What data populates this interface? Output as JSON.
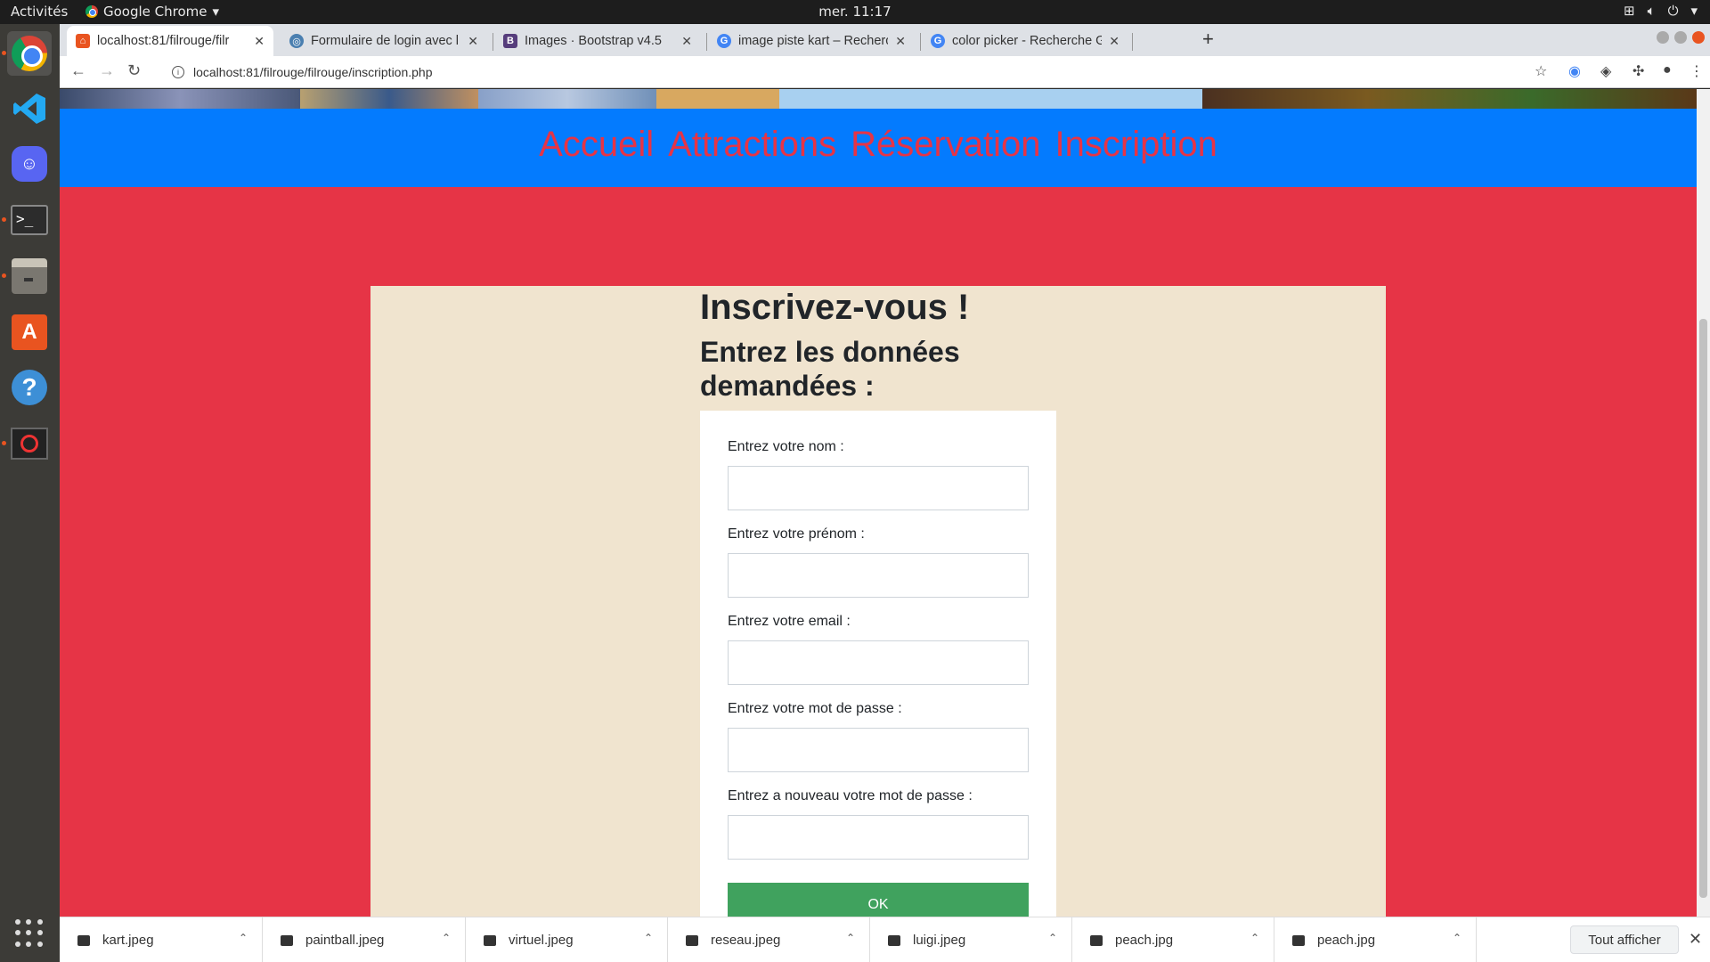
{
  "topbar": {
    "activities": "Activités",
    "app_name": "Google Chrome",
    "clock": "mer. 11:17"
  },
  "dock": {
    "apps": [
      "Google Chrome",
      "Visual Studio Code",
      "Discord",
      "Terminal",
      "Files",
      "Ubuntu Software",
      "Help",
      "Blocked app",
      "Show Applications"
    ]
  },
  "browser": {
    "tabs": [
      {
        "title": "localhost:81/filrouge/filr",
        "favicon": "site-icon",
        "color": "#e95420",
        "active": true
      },
      {
        "title": "Formulaire de login avec l",
        "favicon": "globe-icon",
        "color": "#4a7fb0",
        "active": false
      },
      {
        "title": "Images · Bootstrap v4.5",
        "favicon": "bootstrap-icon",
        "color": "#563d7c",
        "active": false
      },
      {
        "title": "image piste kart – Recherc",
        "favicon": "google-icon",
        "color": "#4285f4",
        "active": false
      },
      {
        "title": "color picker - Recherche G",
        "favicon": "google-icon",
        "color": "#4285f4",
        "active": false
      }
    ],
    "url": "localhost:81/filrouge/filrouge/inscription.php"
  },
  "page": {
    "nav": [
      "Accueil",
      "Attractions",
      "Réservation",
      "Inscription"
    ],
    "title": "Inscrivez-vous !",
    "subtitle": "Entrez les données demandées :",
    "form": {
      "fields": [
        {
          "label": "Entrez votre nom :",
          "value": "",
          "type": "text"
        },
        {
          "label": "Entrez votre prénom :",
          "value": "",
          "type": "text"
        },
        {
          "label": "Entrez votre email :",
          "value": "",
          "type": "email"
        },
        {
          "label": "Entrez votre mot de passe :",
          "value": "",
          "type": "password"
        },
        {
          "label": "Entrez a nouveau votre mot de passe :",
          "value": "",
          "type": "password"
        }
      ],
      "submit": "OK"
    },
    "colors": {
      "page_bg": "#e63446",
      "nav_bg": "#047bfe",
      "panel_bg": "#f0e4cf",
      "button": "#40a25e"
    }
  },
  "downloads": {
    "items": [
      "kart.jpeg",
      "paintball.jpeg",
      "virtuel.jpeg",
      "reseau.jpeg",
      "luigi.jpeg",
      "peach.jpg",
      "peach.jpg"
    ],
    "show_all": "Tout afficher"
  }
}
